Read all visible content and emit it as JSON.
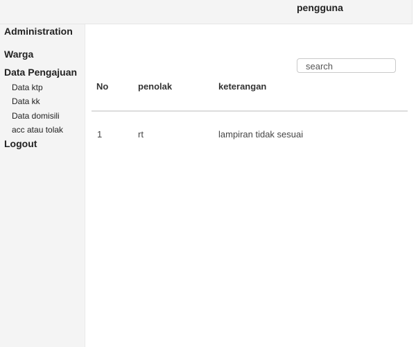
{
  "header": {
    "user_label": "pengguna"
  },
  "sidebar": {
    "administration": "Administration",
    "warga": "Warga",
    "data_pengajuan": "Data Pengajuan",
    "submenu": [
      "Data ktp",
      "Data kk",
      "Data domisili",
      "acc atau tolak"
    ],
    "logout": "Logout"
  },
  "search": {
    "placeholder": "search",
    "value": ""
  },
  "table": {
    "columns": [
      "No",
      "penolak",
      "keterangan"
    ],
    "rows": [
      [
        "1",
        "rt",
        "lampiran tidak sesuai"
      ]
    ]
  }
}
